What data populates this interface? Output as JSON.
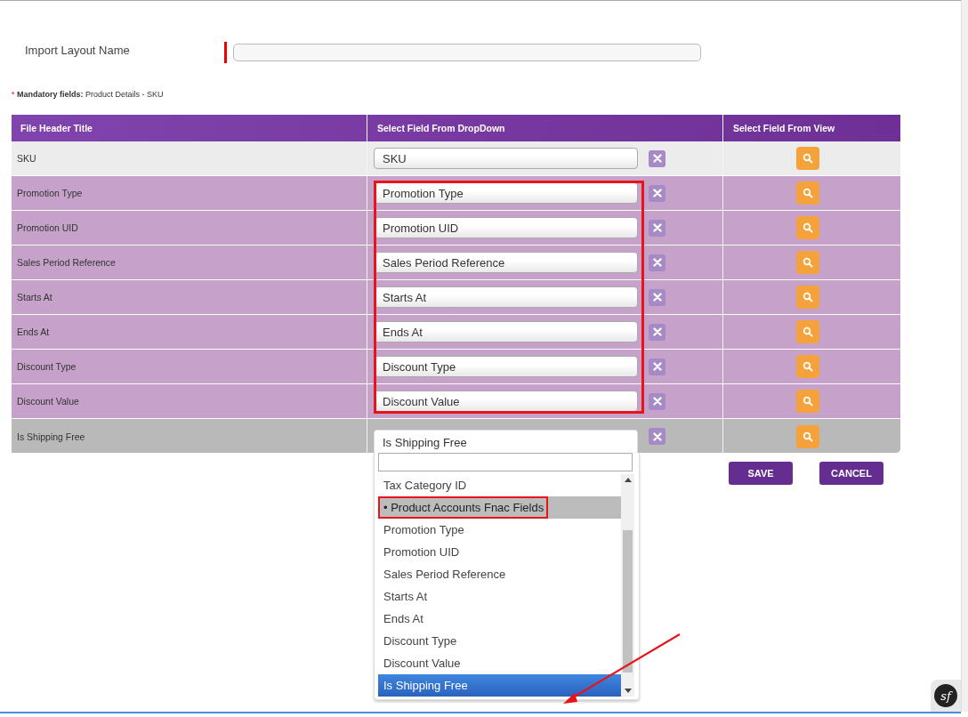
{
  "layout_name": {
    "label": "Import Layout Name"
  },
  "mandatory": {
    "mark": "*",
    "text": "**Mandatory fields:** Product Details - SKU"
  },
  "table": {
    "columns": [
      "File Header Title",
      "Select Field From DropDown",
      "Select Field From View"
    ],
    "rows": [
      {
        "title": "SKU",
        "field": "SKU",
        "kind": "mandatory",
        "highlighted": false,
        "open": false
      },
      {
        "title": "Promotion Type",
        "field": "Promotion Type",
        "kind": "mapped",
        "highlighted": true,
        "open": false
      },
      {
        "title": "Promotion UID",
        "field": "Promotion UID",
        "kind": "mapped",
        "highlighted": true,
        "open": false
      },
      {
        "title": "Sales Period Reference",
        "field": "Sales Period Reference",
        "kind": "mapped",
        "highlighted": true,
        "open": false
      },
      {
        "title": "Starts At",
        "field": "Starts At",
        "kind": "mapped",
        "highlighted": true,
        "open": false
      },
      {
        "title": "Ends At",
        "field": "Ends At",
        "kind": "mapped",
        "highlighted": true,
        "open": false
      },
      {
        "title": "Discount Type",
        "field": "Discount Type",
        "kind": "mapped",
        "highlighted": true,
        "open": false
      },
      {
        "title": "Discount Value",
        "field": "Discount Value",
        "kind": "mapped",
        "highlighted": true,
        "open": false
      },
      {
        "title": "Is Shipping Free",
        "field": "Is Shipping Free",
        "kind": "active",
        "highlighted": false,
        "open": true
      }
    ]
  },
  "dropdown": {
    "options": [
      {
        "label": "Tax Category ID",
        "selected": false,
        "highlighted": false
      },
      {
        "label": "• Product Accounts Fnac Fields",
        "selected": false,
        "highlighted": true
      },
      {
        "label": "Promotion Type",
        "selected": false,
        "highlighted": false
      },
      {
        "label": "Promotion UID",
        "selected": false,
        "highlighted": false
      },
      {
        "label": "Sales Period Reference",
        "selected": false,
        "highlighted": false
      },
      {
        "label": "Starts At",
        "selected": false,
        "highlighted": false
      },
      {
        "label": "Ends At",
        "selected": false,
        "highlighted": false
      },
      {
        "label": "Discount Type",
        "selected": false,
        "highlighted": false
      },
      {
        "label": "Discount Value",
        "selected": false,
        "highlighted": false
      },
      {
        "label": "Is Shipping Free",
        "selected": true,
        "highlighted": false
      }
    ]
  },
  "pointer_arrow": true,
  "buttons": [
    "SAVE",
    "CANCEL"
  ],
  "logo": "sf"
}
